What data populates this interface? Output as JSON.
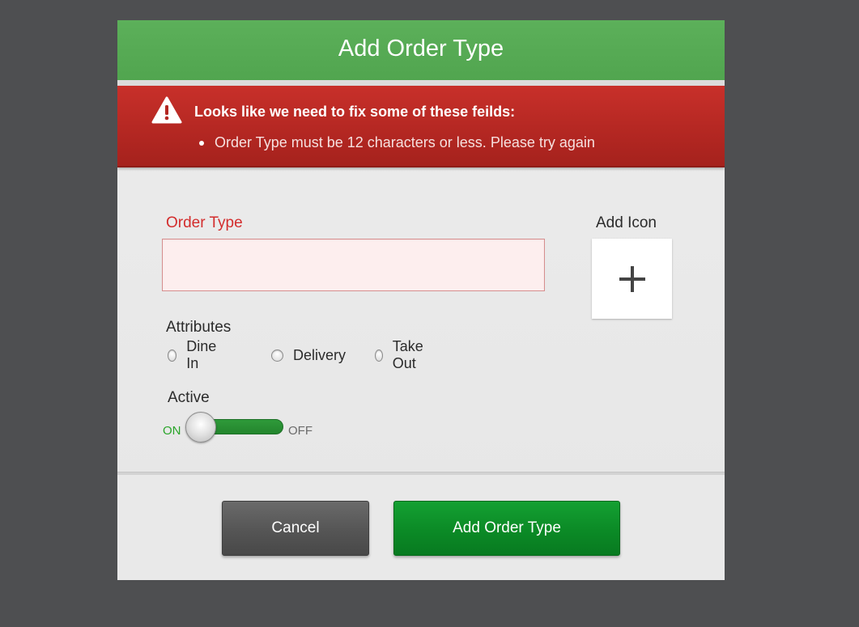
{
  "dialog": {
    "title": "Add Order Type"
  },
  "error": {
    "heading": "Looks like we need to fix some of these feilds:",
    "items": [
      "Order Type must be 12 characters or less. Please try again"
    ],
    "icon": "warning-icon"
  },
  "form": {
    "order_type_label": "Order Type",
    "order_type_value": "",
    "add_icon_label": "Add Icon",
    "add_icon_symbol": "plus-icon",
    "attributes_label": "Attributes",
    "attributes": [
      {
        "label": "Dine In",
        "selected": false
      },
      {
        "label": "Delivery",
        "selected": false
      },
      {
        "label": "Take Out",
        "selected": false
      }
    ],
    "active_label": "Active",
    "toggle_on_label": "ON",
    "toggle_off_label": "OFF"
  },
  "footer": {
    "cancel_label": "Cancel",
    "submit_label": "Add Order Type"
  },
  "colors": {
    "title_bar": "#5cb05a",
    "error_banner": "#b32722",
    "error_text": "#d32d2d",
    "primary_button": "#0b8a26",
    "cancel_button": "#555555",
    "background": "#4e4f51"
  }
}
